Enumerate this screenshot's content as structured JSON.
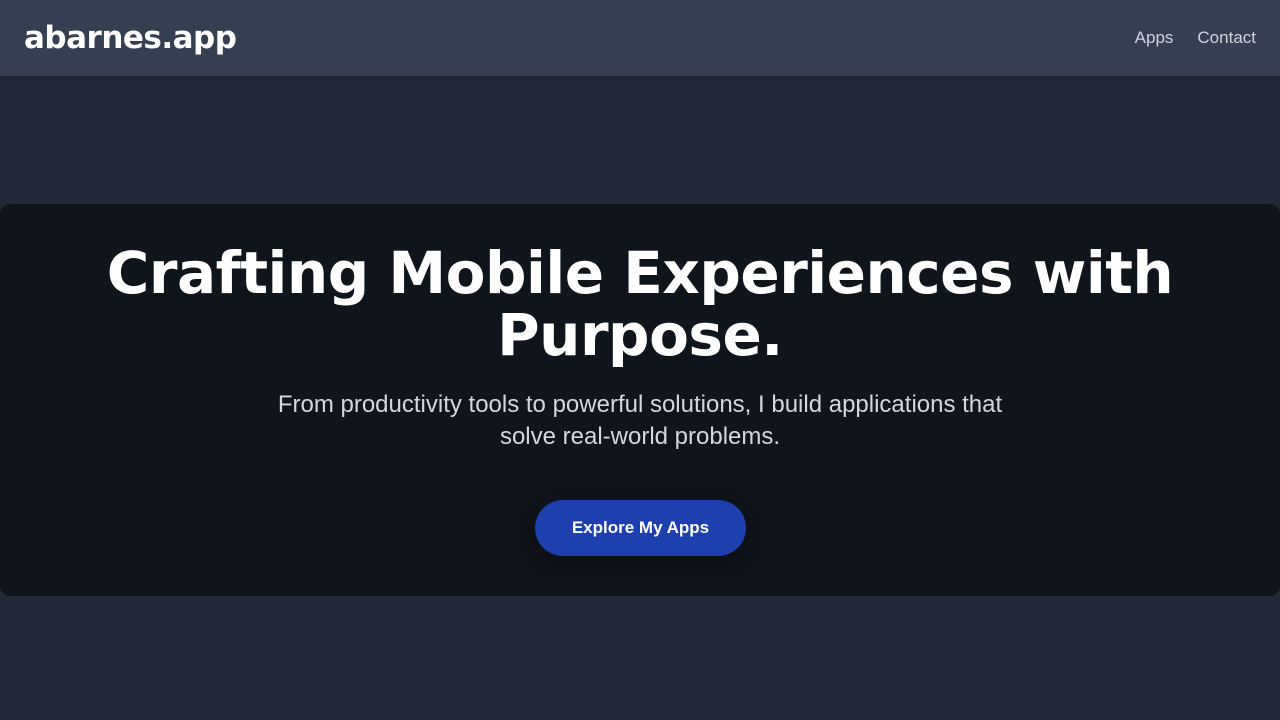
{
  "header": {
    "brand": "abarnes.app",
    "nav": [
      {
        "label": "Apps"
      },
      {
        "label": "Contact"
      }
    ]
  },
  "hero": {
    "title": "Crafting Mobile Experiences with Purpose.",
    "subtitle": "From productivity tools to powerful solutions, I build applications that solve real-world problems.",
    "cta_label": "Explore My Apps"
  },
  "colors": {
    "page_background": "#212936",
    "header_background": "#363f51",
    "hero_background": "#10141b",
    "accent": "#1e40af"
  }
}
